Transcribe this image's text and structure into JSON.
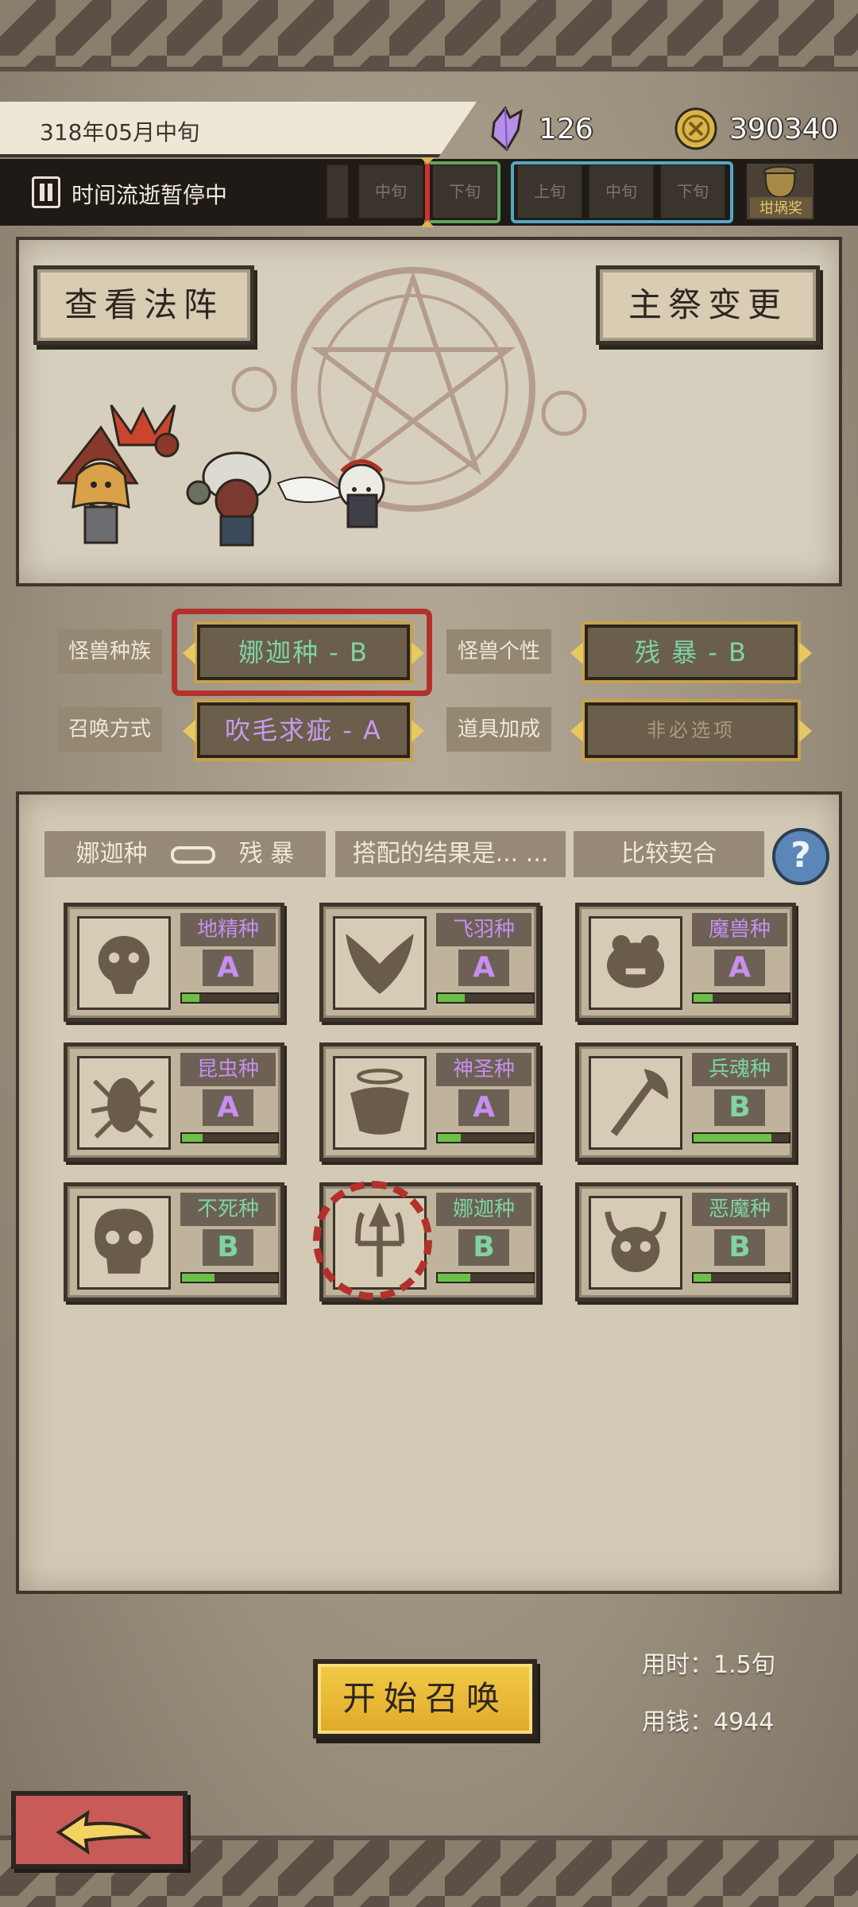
{
  "header": {
    "date": "318年05月中旬",
    "crystal_count": "126",
    "coin_count": "390340"
  },
  "time_bar": {
    "status": "时间流逝暂停中",
    "periods": [
      "中旬",
      "下旬",
      "上旬",
      "中旬",
      "下旬"
    ],
    "jar_label": "坩埚奖"
  },
  "top_panel": {
    "view_array_label": "查看法阵",
    "change_priest_label": "主祭变更"
  },
  "selectors": {
    "race_label": "怪兽种族",
    "race_value": "娜迦种 - B",
    "personality_label": "怪兽个性",
    "personality_value": "残  暴 - B",
    "method_label": "召唤方式",
    "method_value": "吹毛求疵 - A",
    "item_label": "道具加成",
    "item_value": "非必选项"
  },
  "combo": {
    "race": "娜迦种",
    "personality": "残  暴",
    "result_prompt": "搭配的结果是... ...",
    "result": "比较契合",
    "help": "?"
  },
  "races": [
    {
      "name": "地精种",
      "grade": "A",
      "progress": 0.18,
      "icon": "goblin-icon"
    },
    {
      "name": "飞羽种",
      "grade": "A",
      "progress": 0.28,
      "icon": "wings-icon"
    },
    {
      "name": "魔兽种",
      "grade": "A",
      "progress": 0.2,
      "icon": "beast-icon"
    },
    {
      "name": "昆虫种",
      "grade": "A",
      "progress": 0.22,
      "icon": "insect-icon"
    },
    {
      "name": "神圣种",
      "grade": "A",
      "progress": 0.24,
      "icon": "holy-icon"
    },
    {
      "name": "兵魂种",
      "grade": "B",
      "progress": 0.82,
      "icon": "weapon-icon"
    },
    {
      "name": "不死种",
      "grade": "B",
      "progress": 0.34,
      "icon": "skull-icon"
    },
    {
      "name": "娜迦种",
      "grade": "B",
      "progress": 0.34,
      "icon": "trident-icon"
    },
    {
      "name": "恶魔种",
      "grade": "B",
      "progress": 0.18,
      "icon": "demon-icon"
    }
  ],
  "footer": {
    "start_label": "开始召唤",
    "time_cost": "用时：1.5旬",
    "money_cost": "用钱：4944"
  },
  "colors": {
    "grade_a": "#c68ff0",
    "grade_b": "#7fd3a6",
    "progress": "#6cc048",
    "start_button": "#e8b83a",
    "back_button": "#c85a58"
  }
}
